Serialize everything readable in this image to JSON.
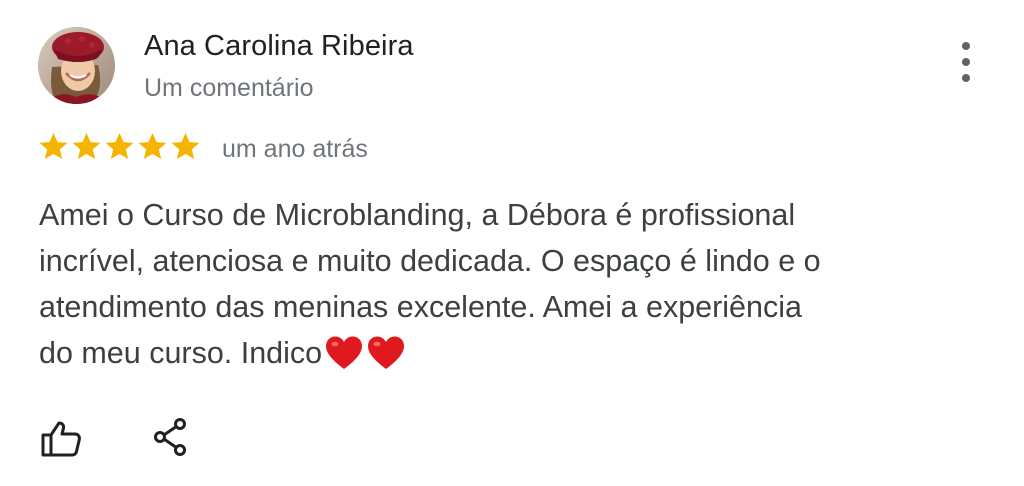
{
  "review": {
    "author": "Ana Carolina Ribeira",
    "author_subtitle": "Um comentário",
    "rating": 5,
    "rating_max": 5,
    "time_ago": "um ano atrás",
    "text_lines": [
      "Amei o Curso de Microblanding, a Débora é profissional",
      "incrível, atenciosa e muito dedicada. O espaço é lindo e o",
      "atendimento das meninas excelente. Amei a experiência",
      "do meu curso. Indico"
    ],
    "emoji": [
      "heart",
      "heart"
    ]
  },
  "icons": {
    "menu": "more-vert-icon",
    "like": "thumbs-up-icon",
    "share": "share-icon",
    "star": "star-icon"
  },
  "colors": {
    "star": "#F4B400",
    "heart": "#E0191E",
    "name": "#202124",
    "secondary": "#70757A",
    "body": "#3C4043",
    "icon": "#202124"
  }
}
